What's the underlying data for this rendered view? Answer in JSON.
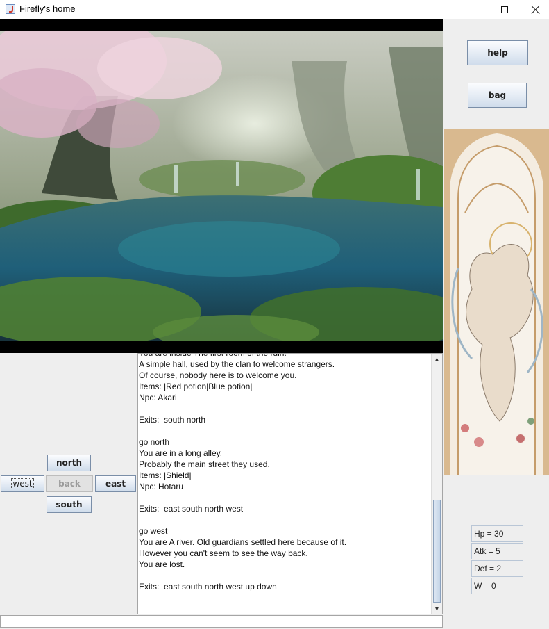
{
  "window": {
    "title": "Firefly's home"
  },
  "side_buttons": {
    "help": "help",
    "bag": "bag"
  },
  "nav": {
    "north": "north",
    "west": "west",
    "back": "back",
    "east": "east",
    "south": "south"
  },
  "log_lines": [
    "You are inside The first room of the ruin.",
    "A simple hall, used by the clan to welcome strangers.",
    "Of course, nobody here is to welcome you.",
    "Items: |Red potion|Blue potion|",
    "Npc: Akari",
    "",
    "Exits:  south north",
    "",
    "go north",
    "You are in a long alley.",
    "Probably the main street they used.",
    "Items: |Shield|",
    "Npc: Hotaru",
    "",
    "Exits:  east south north west",
    "",
    "go west",
    "You are A river. Old guardians settled here because of it.",
    "However you can't seem to see the way back.",
    "You are lost.",
    "",
    "Exits:  east south north west up down"
  ],
  "command_input": {
    "value": ""
  },
  "stats": {
    "hp": "Hp = 30",
    "atk": "Atk = 5",
    "def": "Def = 2",
    "w": "W = 0"
  },
  "colors": {
    "button_border": "#7a8ea8",
    "stat_border": "#b9c6d6",
    "background": "#eeeeee"
  }
}
